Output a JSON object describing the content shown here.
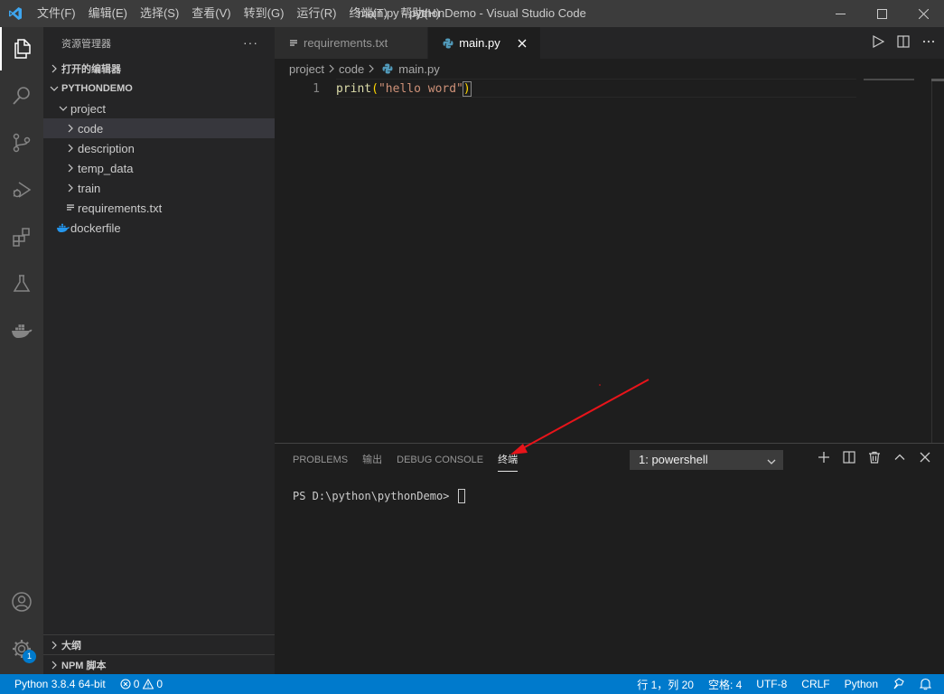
{
  "window": {
    "title": "main.py - pythonDemo - Visual Studio Code",
    "menu": [
      "文件(F)",
      "编辑(E)",
      "选择(S)",
      "查看(V)",
      "转到(G)",
      "运行(R)",
      "终端(T)",
      "帮助(H)"
    ]
  },
  "sidebar": {
    "header": "资源管理器",
    "more": "···",
    "open_editors": "打开的编辑器",
    "workspace": "PYTHONDEMO",
    "tree": [
      {
        "label": "project"
      },
      {
        "label": "code"
      },
      {
        "label": "description"
      },
      {
        "label": "temp_data"
      },
      {
        "label": "train"
      },
      {
        "label": "requirements.txt"
      },
      {
        "label": "dockerfile"
      }
    ],
    "outline": "大纲",
    "npm": "NPM 脚本"
  },
  "tabs": [
    {
      "label": "requirements.txt"
    },
    {
      "label": "main.py"
    }
  ],
  "breadcrumb": {
    "parts": [
      "project",
      "code",
      "main.py"
    ]
  },
  "editor": {
    "line_number": "1",
    "code": {
      "fn": "print",
      "open": "(",
      "str": "\"hello word\"",
      "close": ")"
    }
  },
  "panel": {
    "tabs": [
      "PROBLEMS",
      "输出",
      "DEBUG CONSOLE",
      "终端"
    ],
    "terminal_select": "1: powershell",
    "prompt": "PS D:\\python\\pythonDemo> "
  },
  "activity": {
    "settings_badge": "1"
  },
  "statusbar": {
    "interpreter": "Python 3.8.4 64-bit",
    "errors": "0",
    "warnings": "0",
    "position": "行 1，列 20",
    "spaces": "空格: 4",
    "encoding": "UTF-8",
    "eol": "CRLF",
    "language": "Python"
  },
  "colors": {
    "accent": "#007acc",
    "annotation_arrow": "#e8141a"
  }
}
